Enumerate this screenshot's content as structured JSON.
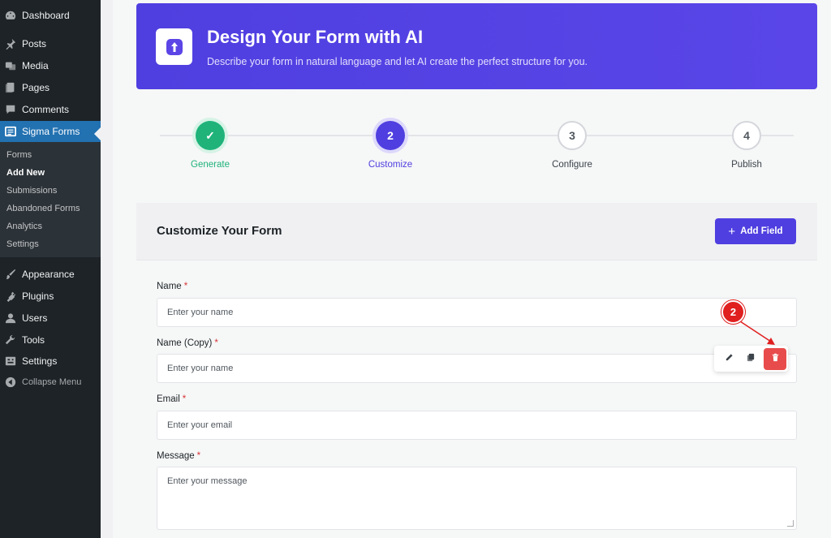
{
  "sidebar": {
    "items": [
      {
        "label": "Dashboard",
        "icon": "dashboard-icon"
      },
      {
        "label": "Posts",
        "icon": "pin-icon"
      },
      {
        "label": "Media",
        "icon": "media-icon"
      },
      {
        "label": "Pages",
        "icon": "pages-icon"
      },
      {
        "label": "Comments",
        "icon": "comment-icon"
      },
      {
        "label": "Sigma Forms",
        "icon": "forms-icon"
      },
      {
        "label": "Appearance",
        "icon": "brush-icon"
      },
      {
        "label": "Plugins",
        "icon": "plugin-icon"
      },
      {
        "label": "Users",
        "icon": "user-icon"
      },
      {
        "label": "Tools",
        "icon": "wrench-icon"
      },
      {
        "label": "Settings",
        "icon": "settings-icon"
      },
      {
        "label": "Collapse Menu",
        "icon": "collapse-icon"
      }
    ],
    "submenu": [
      "Forms",
      "Add New",
      "Submissions",
      "Abandoned Forms",
      "Analytics",
      "Settings"
    ],
    "current_submenu": "Add New"
  },
  "hero": {
    "title": "Design Your Form with AI",
    "subtitle": "Describe your form in natural language and let AI create the perfect structure for you."
  },
  "steps": [
    {
      "number": "✓",
      "label": "Generate",
      "state": "done"
    },
    {
      "number": "2",
      "label": "Customize",
      "state": "current"
    },
    {
      "number": "3",
      "label": "Configure",
      "state": "todo"
    },
    {
      "number": "4",
      "label": "Publish",
      "state": "todo"
    }
  ],
  "card": {
    "title": "Customize Your Form",
    "add_field_label": "Add Field"
  },
  "fields": [
    {
      "label": "Name",
      "required": "*",
      "placeholder": "Enter your name",
      "type": "text"
    },
    {
      "label": "Name (Copy)",
      "required": "*",
      "placeholder": "Enter your name",
      "type": "text"
    },
    {
      "label": "Email",
      "required": "*",
      "placeholder": "Enter your email",
      "type": "text"
    },
    {
      "label": "Message",
      "required": "*",
      "placeholder": "Enter your message",
      "type": "textarea"
    }
  ],
  "annotation": {
    "badge": "2"
  },
  "colors": {
    "accent": "#4f3fe0",
    "success": "#1fb37a",
    "danger": "#e84b4b",
    "sidebar": "#1d2327",
    "wp_blue": "#2271b1"
  }
}
